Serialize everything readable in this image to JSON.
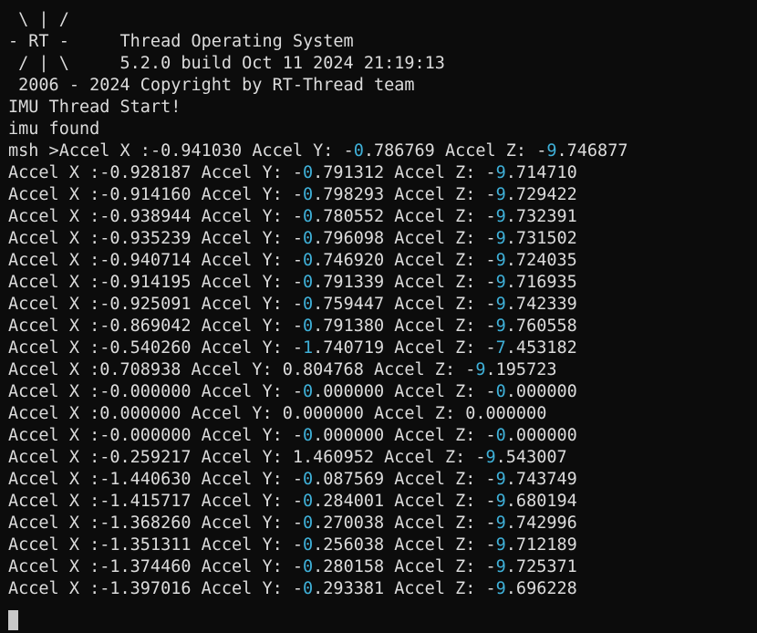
{
  "terminal": {
    "colors": {
      "background": "#0c0c0c",
      "foreground": "#dcdcdc",
      "highlight": "#3fb0d8",
      "cursor": "#c8c8c8"
    },
    "banner": {
      "line1": " \\ | /",
      "line2": "- RT -     Thread Operating System",
      "line3": " / | \\     5.2.0 build Oct 11 2024 21:19:13",
      "line4": " 2006 - 2024 Copyright by RT-Thread team"
    },
    "messages": {
      "imu_start": "IMU Thread Start!",
      "imu_found": "imu found"
    },
    "prompt": "msh >",
    "readings": [
      {
        "x": ":-0.941030",
        "y": "0.786769",
        "y_neg": true,
        "z": "9.746877",
        "z_neg": true
      },
      {
        "x": ":-0.928187",
        "y": "0.791312",
        "y_neg": true,
        "z": "9.714710",
        "z_neg": true
      },
      {
        "x": ":-0.914160",
        "y": "0.798293",
        "y_neg": true,
        "z": "9.729422",
        "z_neg": true
      },
      {
        "x": ":-0.938944",
        "y": "0.780552",
        "y_neg": true,
        "z": "9.732391",
        "z_neg": true
      },
      {
        "x": ":-0.935239",
        "y": "0.796098",
        "y_neg": true,
        "z": "9.731502",
        "z_neg": true
      },
      {
        "x": ":-0.940714",
        "y": "0.746920",
        "y_neg": true,
        "z": "9.724035",
        "z_neg": true
      },
      {
        "x": ":-0.914195",
        "y": "0.791339",
        "y_neg": true,
        "z": "9.716935",
        "z_neg": true
      },
      {
        "x": ":-0.925091",
        "y": "0.759447",
        "y_neg": true,
        "z": "9.742339",
        "z_neg": true
      },
      {
        "x": ":-0.869042",
        "y": "0.791380",
        "y_neg": true,
        "z": "9.760558",
        "z_neg": true
      },
      {
        "x": ":-0.540260",
        "y": "1.740719",
        "y_neg": true,
        "z": "7.453182",
        "z_neg": true
      },
      {
        "x": ":0.708938",
        "y": "0.804768",
        "y_neg": false,
        "z": "9.195723",
        "z_neg": true
      },
      {
        "x": ":-0.000000",
        "y": "0.000000",
        "y_neg": true,
        "z": "0.000000",
        "z_neg": true
      },
      {
        "x": ":0.000000",
        "y": "0.000000",
        "y_neg": false,
        "z": "0.000000",
        "z_neg": false
      },
      {
        "x": ":-0.000000",
        "y": "0.000000",
        "y_neg": true,
        "z": "0.000000",
        "z_neg": true
      },
      {
        "x": ":-0.259217",
        "y": "1.460952",
        "y_neg": false,
        "z": "9.543007",
        "z_neg": true
      },
      {
        "x": ":-1.440630",
        "y": "0.087569",
        "y_neg": true,
        "z": "9.743749",
        "z_neg": true
      },
      {
        "x": ":-1.415717",
        "y": "0.284001",
        "y_neg": true,
        "z": "9.680194",
        "z_neg": true
      },
      {
        "x": ":-1.368260",
        "y": "0.270038",
        "y_neg": true,
        "z": "9.742996",
        "z_neg": true
      },
      {
        "x": ":-1.351311",
        "y": "0.256038",
        "y_neg": true,
        "z": "9.712189",
        "z_neg": true
      },
      {
        "x": ":-1.374460",
        "y": "0.280158",
        "y_neg": true,
        "z": "9.725371",
        "z_neg": true
      },
      {
        "x": ":-1.397016",
        "y": "0.293381",
        "y_neg": true,
        "z": "9.696228",
        "z_neg": true
      }
    ]
  }
}
